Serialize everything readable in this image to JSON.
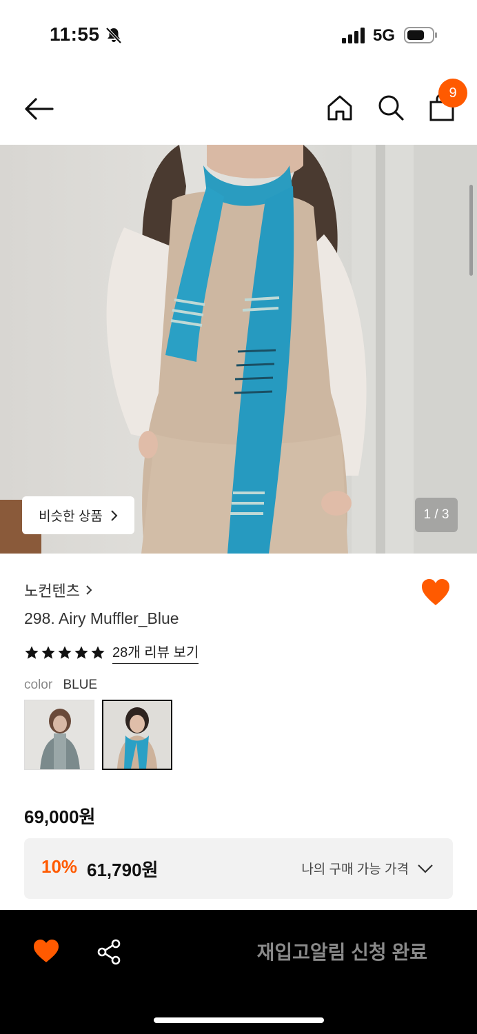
{
  "status_bar": {
    "time": "11:55",
    "network": "5G",
    "icons": [
      "bell-slash-icon",
      "signal-icon",
      "battery-icon"
    ]
  },
  "header": {
    "icons": [
      "back-arrow-icon",
      "home-icon",
      "search-icon",
      "shopping-bag-icon"
    ],
    "cart_count": "9"
  },
  "gallery": {
    "similar_button_label": "비슷한 상품",
    "page_indicator": "1 / 3"
  },
  "product": {
    "brand": "노컨텐츠",
    "name": "298. Airy Muffler_Blue",
    "rating_stars": 5,
    "review_link": "28개 리뷰 보기",
    "color_key": "color",
    "color_value": "BLUE",
    "swatches": [
      "grey-scarf",
      "blue-scarf"
    ],
    "selected_swatch": 1
  },
  "price": {
    "original": "69,000원",
    "discount_rate": "10%",
    "discount_price": "61,790원",
    "my_price_label": "나의 구매 가능 가격"
  },
  "bottom_bar": {
    "restock_label": "재입고알림 신청 완료"
  },
  "colors": {
    "accent": "#ff5a00",
    "bottom_bar_bg": "#000000",
    "price_box_bg": "#f2f2f2"
  }
}
